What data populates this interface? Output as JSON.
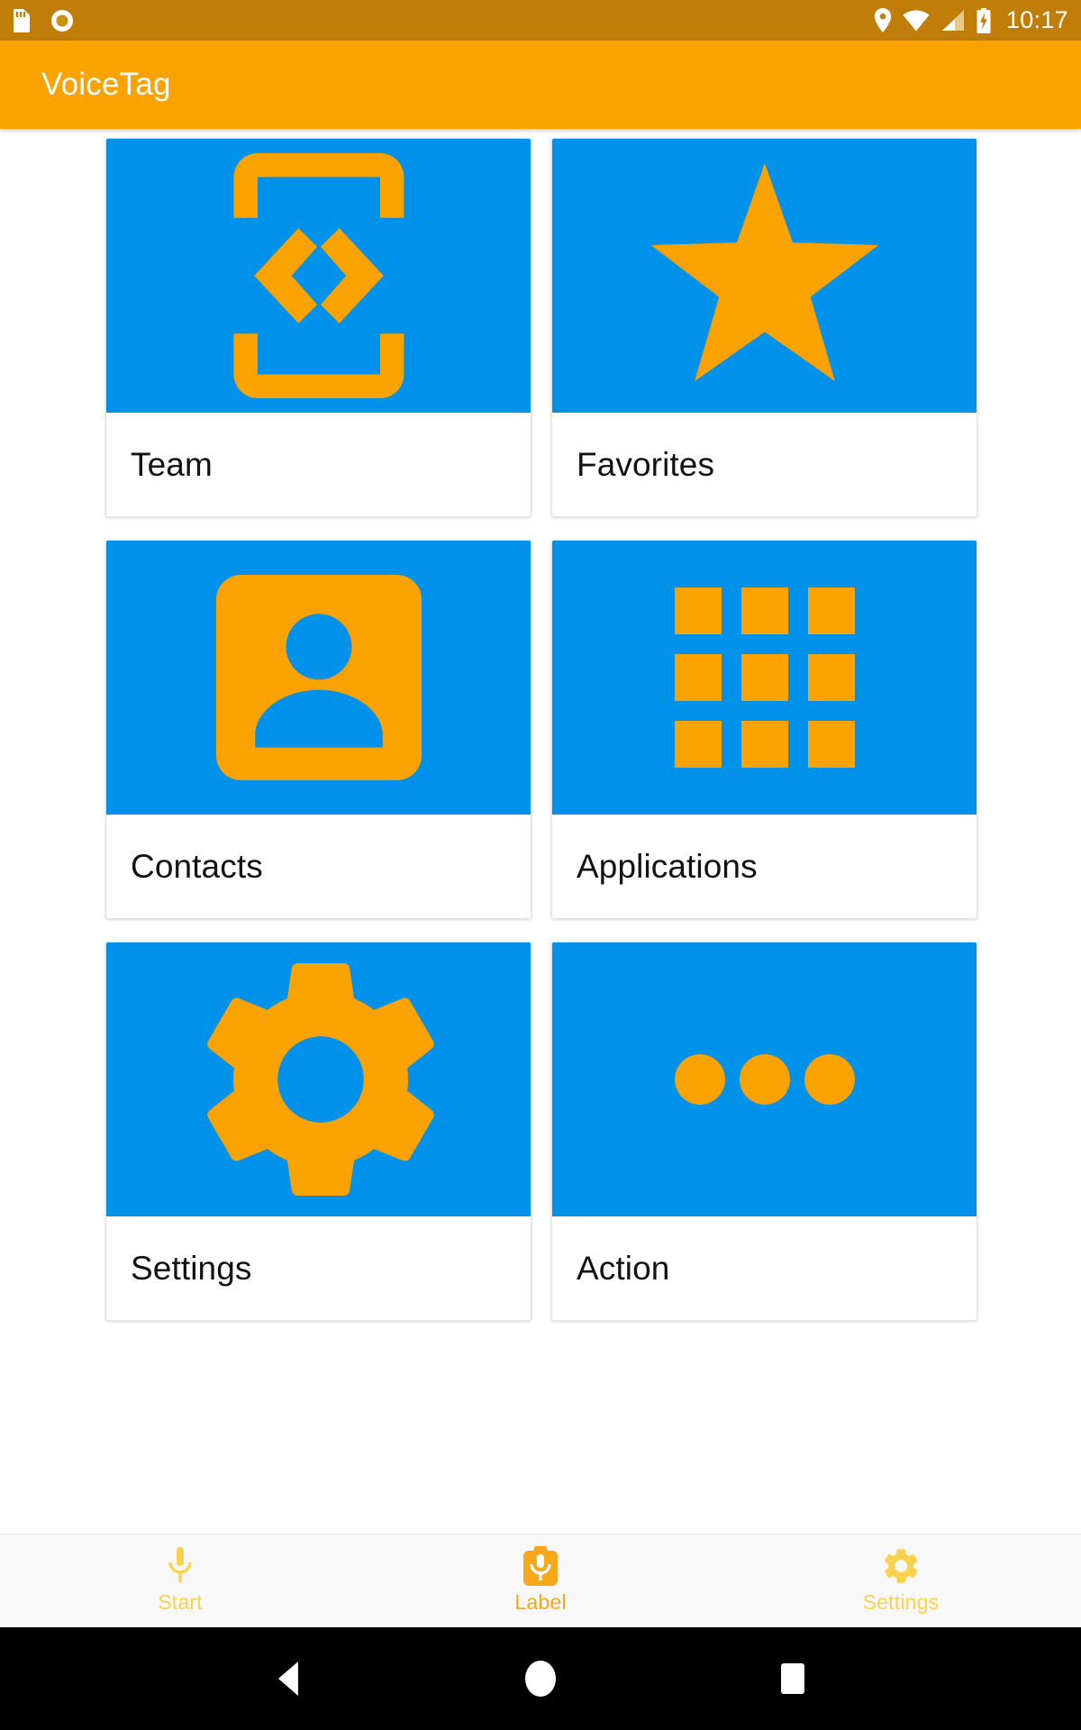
{
  "status_bar": {
    "left_icons": [
      "sd-card-icon",
      "circle-record-icon"
    ],
    "right_icons": [
      "location-pin-icon",
      "wifi-icon",
      "signal-cellular-icon",
      "battery-charging-icon"
    ],
    "time": "10:17",
    "background": "#C07D08"
  },
  "app_bar": {
    "title": "VoiceTag",
    "background": "#FAA200",
    "text_color": "#FFFFFF"
  },
  "grid": {
    "tile_bg": "#0091EA",
    "icon_color": "#FAA200",
    "cards": [
      {
        "label": "Team",
        "icon": "developer-mode-brackets-icon"
      },
      {
        "label": "Favorites",
        "icon": "star-icon"
      },
      {
        "label": "Contacts",
        "icon": "account-box-icon"
      },
      {
        "label": "Applications",
        "icon": "apps-grid-icon"
      },
      {
        "label": "Settings",
        "icon": "gear-icon"
      },
      {
        "label": "Action",
        "icon": "more-horiz-dots-icon"
      }
    ]
  },
  "bottom_nav": {
    "background": "#F8F8F8",
    "active_color": "#F8A81B",
    "inactive_color": "#FBD24E",
    "items": [
      {
        "label": "Start",
        "icon": "microphone-icon",
        "active": false
      },
      {
        "label": "Label",
        "icon": "microphone-badge-icon",
        "active": true
      },
      {
        "label": "Settings",
        "icon": "gear-icon",
        "active": false
      }
    ]
  },
  "system_nav": {
    "background": "#000000",
    "buttons": [
      {
        "name": "back-button",
        "icon": "triangle-back-icon"
      },
      {
        "name": "home-button",
        "icon": "circle-home-icon"
      },
      {
        "name": "recents-button",
        "icon": "square-recents-icon"
      }
    ]
  }
}
